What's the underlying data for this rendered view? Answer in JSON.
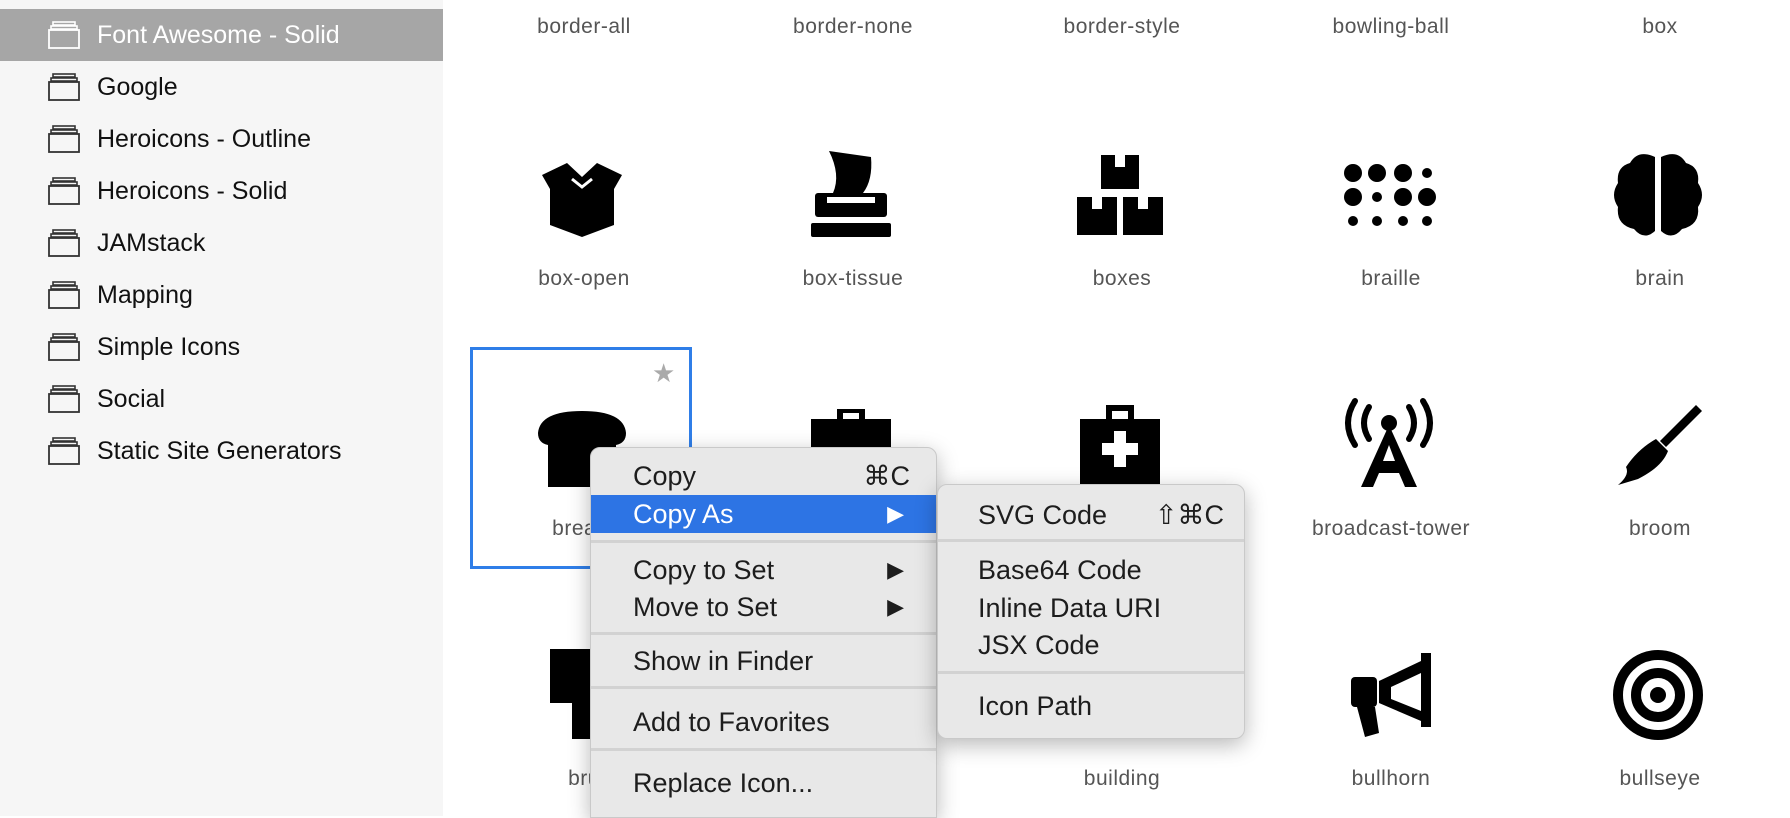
{
  "sidebar": {
    "items": [
      {
        "label": "Font Awesome - Solid",
        "selected": true
      },
      {
        "label": "Google"
      },
      {
        "label": "Heroicons - Outline"
      },
      {
        "label": "Heroicons - Solid"
      },
      {
        "label": "JAMstack"
      },
      {
        "label": "Mapping"
      },
      {
        "label": "Simple Icons"
      },
      {
        "label": "Social"
      },
      {
        "label": "Static Site Generators"
      }
    ]
  },
  "grid": {
    "row1": [
      "border-all",
      "border-none",
      "border-style",
      "bowling-ball",
      "box"
    ],
    "row2": [
      "box-open",
      "box-tissue",
      "boxes",
      "braille",
      "brain"
    ],
    "row3": [
      "bread-",
      "broadcast-tower",
      "broom"
    ],
    "row4": [
      "bru",
      "building",
      "bullhorn",
      "bullseye"
    ]
  },
  "selected_icon": {
    "star": "★"
  },
  "context_menu": {
    "copy": {
      "label": "Copy",
      "shortcut": "⌘C"
    },
    "copy_as": {
      "label": "Copy As",
      "arrow": "▶"
    },
    "copy_to_set": {
      "label": "Copy to Set",
      "arrow": "▶"
    },
    "move_to_set": {
      "label": "Move to Set",
      "arrow": "▶"
    },
    "show_in_finder": "Show in Finder",
    "add_to_favorites": "Add to Favorites",
    "replace_icon": "Replace Icon..."
  },
  "submenu": {
    "svg_code": {
      "label": "SVG Code",
      "shortcut": "⇧⌘C"
    },
    "base64_code": "Base64 Code",
    "inline_data_uri": "Inline Data URI",
    "jsx_code": "JSX Code",
    "icon_path": "Icon Path"
  },
  "colors": {
    "accent": "#2d74e4",
    "selection": "#2f7ee8",
    "sidebar_selected": "#a6a6a6"
  }
}
